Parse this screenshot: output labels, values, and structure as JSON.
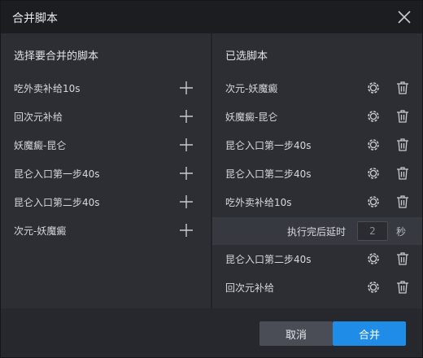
{
  "dialog": {
    "title": "合并脚本",
    "close_icon": "close-icon"
  },
  "left_panel": {
    "header": "选择要合并的脚本",
    "items": [
      {
        "label": "吃外卖补给10s"
      },
      {
        "label": "回次元补给"
      },
      {
        "label": "妖魔癜-昆仑"
      },
      {
        "label": "昆仑入口第一步40s"
      },
      {
        "label": "昆仑入口第二步40s"
      },
      {
        "label": "次元-妖魔癜"
      }
    ],
    "item_icon": "plus-icon"
  },
  "right_panel": {
    "header": "已选脚本",
    "items_before_delay": [
      {
        "label": "次元-妖魔癜"
      },
      {
        "label": "妖魔癜-昆仑"
      },
      {
        "label": "昆仑入口第一步40s"
      },
      {
        "label": "昆仑入口第二步40s"
      },
      {
        "label": "吃外卖补给10s"
      }
    ],
    "delay": {
      "label": "执行完后延时",
      "value": "2",
      "unit": "秒"
    },
    "items_after_delay": [
      {
        "label": "昆仑入口第二步40s"
      },
      {
        "label": "回次元补给"
      }
    ],
    "item_icons": [
      "gear-icon",
      "trash-icon"
    ]
  },
  "footer": {
    "cancel_label": "取消",
    "merge_label": "合并"
  },
  "colors": {
    "accent": "#1f8ce8",
    "background": "#2c2e33",
    "titlebar": "#1b1d21"
  }
}
